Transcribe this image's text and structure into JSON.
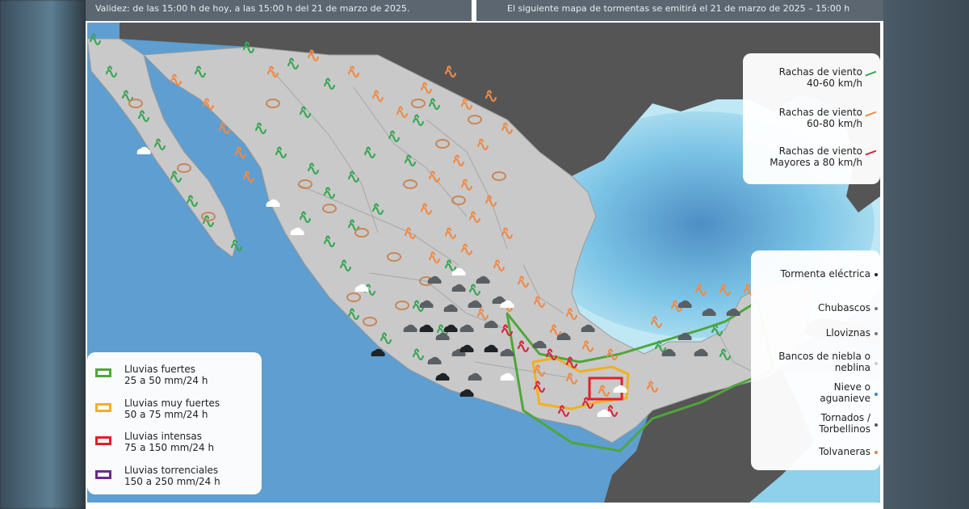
{
  "header": {
    "validity": "Validez:  de las 15:00 h de hoy, a las 15:00  h del 21 de marzo de 2025.",
    "next_map": "El siguiente mapa de tormentas  se emitirá  el 21 de marzo de 2025 – 15:00 h"
  },
  "wind_legend": [
    {
      "label": "Rachas de viento",
      "range": "40-60 km/h",
      "color": "#3aa655"
    },
    {
      "label": "Rachas de viento",
      "range": "60-80 km/h",
      "color": "#f08a46"
    },
    {
      "label": "Rachas de viento",
      "range": "Mayores a 80 km/h",
      "color": "#d8263a"
    }
  ],
  "phenomena_legend": [
    {
      "label": "Tormenta eléctrica",
      "color": "#222222"
    },
    {
      "label": "Chubascos",
      "color": "#777777"
    },
    {
      "label": "Lloviznas",
      "color": "#777777"
    },
    {
      "label": "Bancos de niebla o",
      "label2": "neblina",
      "color": "#cccccc"
    },
    {
      "label": "Nieve o",
      "label2": "aguanieve",
      "color": "#2a8ad4"
    },
    {
      "label": "Tornados /",
      "label2": "Torbellinos",
      "color": "#555555"
    },
    {
      "label": "Tolvaneras",
      "color": "#c8875a"
    }
  ],
  "rain_legend": [
    {
      "label": "Lluvias fuertes",
      "range": "25 a 50 mm/24 h",
      "color": "#4fa63a"
    },
    {
      "label": "Lluvias muy fuertes",
      "range": "50 a 75 mm/24 h",
      "color": "#f2b01e"
    },
    {
      "label": "Lluvias intensas",
      "range": "75 a 150 mm/24 h",
      "color": "#e0202a"
    },
    {
      "label": "Lluvias torrenciales",
      "range": "150 a 250 mm/24 h",
      "color": "#6a2c8a"
    }
  ],
  "colors": {
    "ocean": "#5e9ed0",
    "land_mexico": "#c9c9c9",
    "land_other": "#555555",
    "shelf": "#a8dcec",
    "wind_green": "#3aa655",
    "wind_orange": "#f08a46",
    "wind_red": "#d8263a",
    "dust_brown": "#c8875a"
  },
  "icons": {
    "wind": "wind-gust-icon",
    "dust": "dust-storm-icon",
    "shower": "shower-cloud-icon",
    "storm": "thunderstorm-icon",
    "fog": "fog-cloud-icon"
  }
}
